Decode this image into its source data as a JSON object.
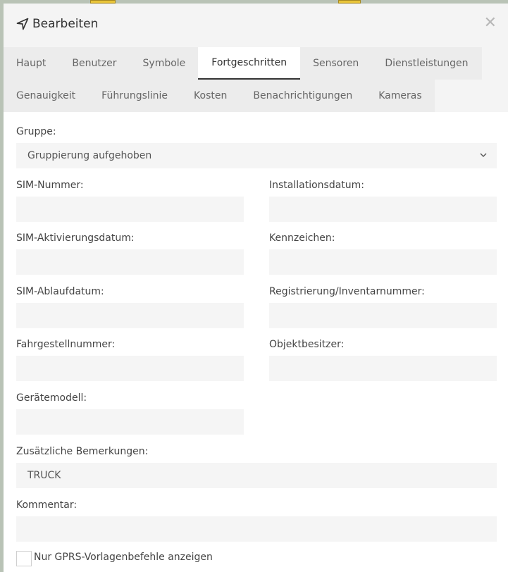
{
  "dialog": {
    "title": "Bearbeiten",
    "close_icon": "close-icon",
    "title_icon": "navigation-arrow-icon"
  },
  "tabs": {
    "row1": [
      "Haupt",
      "Benutzer",
      "Symbole",
      "Fortgeschritten",
      "Sensoren",
      "Dienstleistungen"
    ],
    "row2": [
      "Genauigkeit",
      "Führungslinie",
      "Kosten",
      "Benachrichtigungen",
      "Kameras"
    ],
    "active": "Fortgeschritten"
  },
  "form": {
    "group_label": "Gruppe:",
    "group_value": "Gruppierung aufgehoben",
    "sim_number_label": "SIM-Nummer:",
    "sim_number_value": "",
    "install_date_label": "Installationsdatum:",
    "install_date_value": "",
    "sim_activation_label": "SIM-Aktivierungsdatum:",
    "sim_activation_value": "",
    "plate_label": "Kennzeichen:",
    "plate_value": "",
    "sim_expiry_label": "SIM-Ablaufdatum:",
    "sim_expiry_value": "",
    "registration_label": "Registrierung/Inventarnummer:",
    "registration_value": "",
    "vin_label": "Fahrgestellnummer:",
    "vin_value": "",
    "owner_label": "Objektbesitzer:",
    "owner_value": "",
    "device_model_label": "Gerätemodell:",
    "device_model_value": "",
    "remarks_label": "Zusätzliche Bemerkungen:",
    "remarks_value": "TRUCK",
    "comment_label": "Kommentar:",
    "comment_value": "",
    "gprs_checkbox_label": "Nur GPRS-Vorlagenbefehle anzeigen",
    "gprs_checked": false
  }
}
